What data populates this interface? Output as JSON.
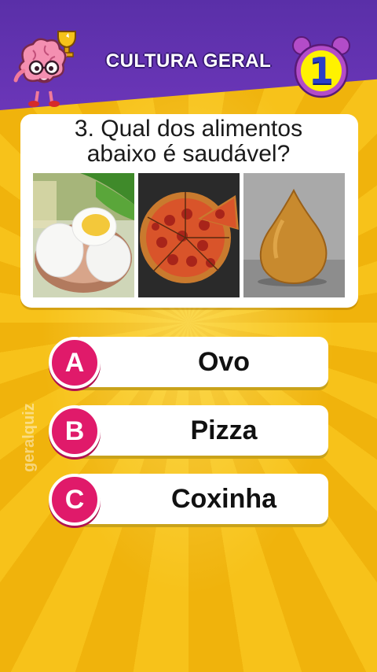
{
  "header": {
    "title": "CULTURA GERAL",
    "timer": "1"
  },
  "question": {
    "line1": "3. Qual dos alimentos",
    "line2": "abaixo é saudável?"
  },
  "images": [
    {
      "name": "eggs-image"
    },
    {
      "name": "pizza-image"
    },
    {
      "name": "coxinha-image"
    }
  ],
  "options": [
    {
      "letter": "A",
      "label": "Ovo"
    },
    {
      "letter": "B",
      "label": "Pizza"
    },
    {
      "letter": "C",
      "label": "Coxinha"
    }
  ],
  "watermark": "geralquiz",
  "colors": {
    "header": "#5a2fa8",
    "background": "#f2b80d",
    "option_badge": "#e01a6a",
    "timer_bg": "#fff200"
  }
}
